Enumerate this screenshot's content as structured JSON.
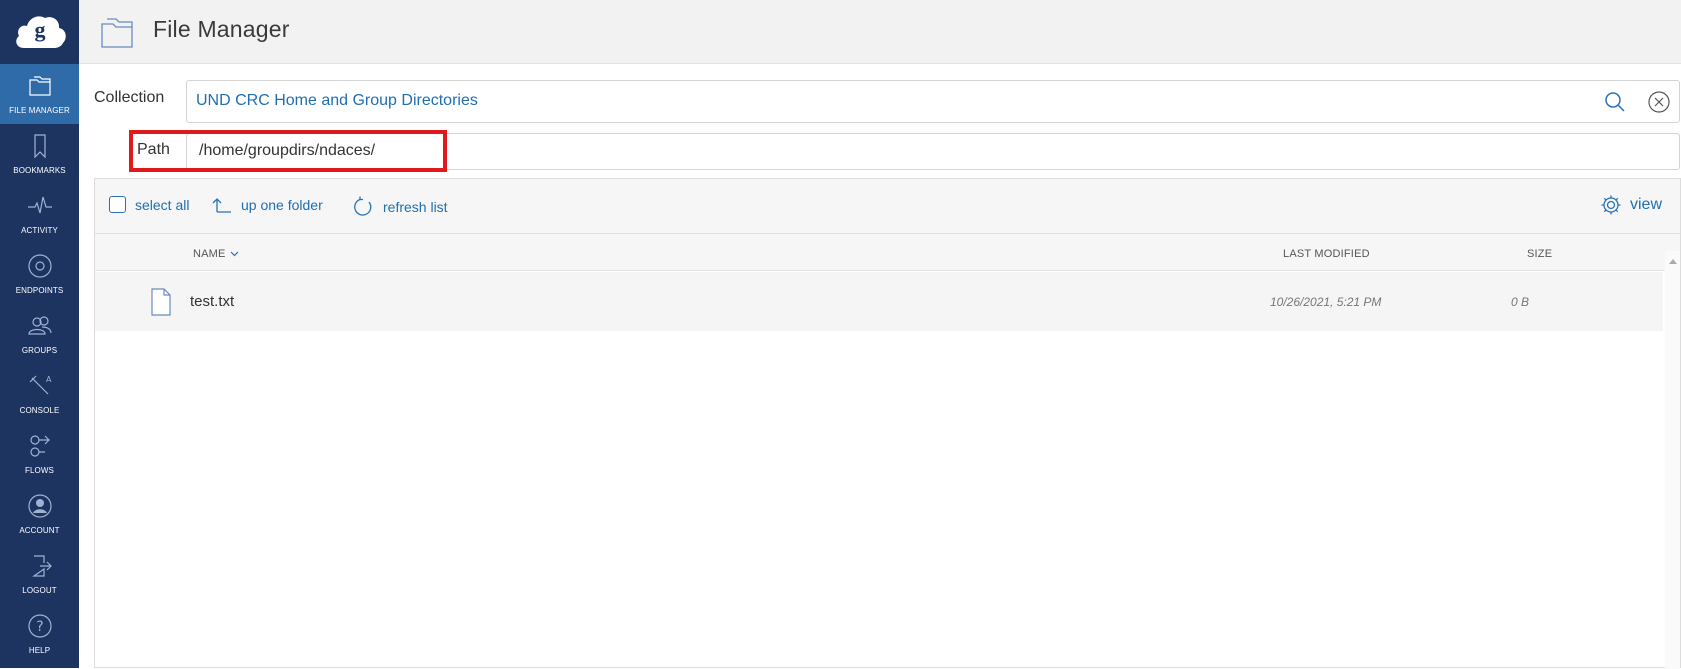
{
  "app": {
    "title": "File Manager"
  },
  "sidebar": {
    "items": [
      {
        "label": "FILE MANAGER",
        "icon": "folder-icon"
      },
      {
        "label": "BOOKMARKS",
        "icon": "bookmark-icon"
      },
      {
        "label": "ACTIVITY",
        "icon": "activity-icon"
      },
      {
        "label": "ENDPOINTS",
        "icon": "endpoints-icon"
      },
      {
        "label": "GROUPS",
        "icon": "groups-icon"
      },
      {
        "label": "CONSOLE",
        "icon": "console-icon"
      },
      {
        "label": "FLOWS",
        "icon": "flows-icon"
      },
      {
        "label": "ACCOUNT",
        "icon": "account-icon"
      },
      {
        "label": "LOGOUT",
        "icon": "logout-icon"
      },
      {
        "label": "HELP",
        "icon": "help-icon"
      }
    ]
  },
  "collection": {
    "label": "Collection",
    "value": "UND CRC Home and Group Directories"
  },
  "path": {
    "label": "Path",
    "value": "/home/groupdirs/ndaces/"
  },
  "toolbar": {
    "select_all": "select all",
    "up_one_folder": "up one folder",
    "refresh_list": "refresh list",
    "view": "view"
  },
  "table": {
    "columns": {
      "name": "NAME",
      "last_modified": "LAST MODIFIED",
      "size": "SIZE"
    },
    "rows": [
      {
        "name": "test.txt",
        "last_modified": "10/26/2021, 5:21 PM",
        "size": "0 B"
      }
    ]
  },
  "colors": {
    "sidebar_bg": "#1d3360",
    "sidebar_active": "#2e6ba8",
    "link": "#1f6fb0",
    "highlight": "#e0191b"
  }
}
